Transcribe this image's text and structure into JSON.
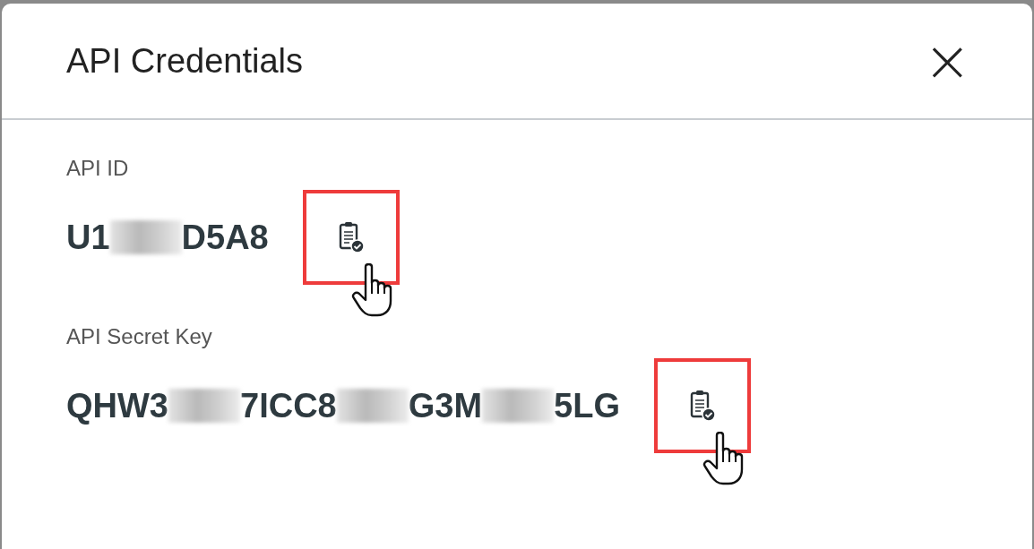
{
  "dialog": {
    "title": "API Credentials",
    "close": "×"
  },
  "fields": [
    {
      "label": "API ID",
      "segments": [
        {
          "kind": "text",
          "text": "U1"
        },
        {
          "kind": "redacted"
        },
        {
          "kind": "text",
          "text": "D5A8"
        }
      ],
      "copy_button": {
        "highlighted": true,
        "hovered": true
      }
    },
    {
      "label": "API Secret Key",
      "segments": [
        {
          "kind": "text",
          "text": "QHW3"
        },
        {
          "kind": "redacted"
        },
        {
          "kind": "text",
          "text": "7ICC8"
        },
        {
          "kind": "redacted"
        },
        {
          "kind": "text",
          "text": "G3M"
        },
        {
          "kind": "redacted"
        },
        {
          "kind": "text",
          "text": "5LG"
        }
      ],
      "copy_button": {
        "highlighted": true,
        "hovered": true
      }
    }
  ]
}
